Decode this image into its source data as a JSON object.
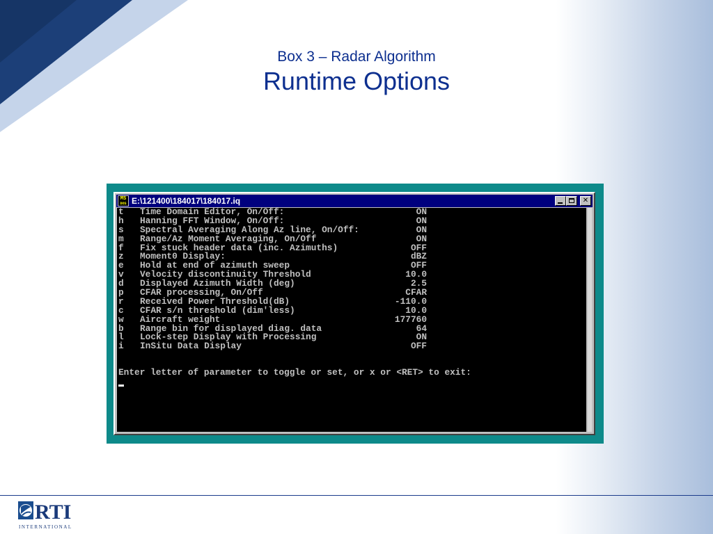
{
  "slide": {
    "title_small": "Box 3 – Radar Algorithm",
    "title_large": "Runtime Options",
    "logo_text": "RTI",
    "logo_subtext": "INTERNATIONAL"
  },
  "window": {
    "title": "E:\\121400\\184017\\184017.iq",
    "icon_text_top": "MS",
    "icon_text_bottom": "DOS",
    "minimize_label": "_",
    "maximize_label": "□",
    "close_label": "✕"
  },
  "console": {
    "options": [
      {
        "key": "t",
        "label": "Time Domain Editor, On/Off:",
        "value": "ON"
      },
      {
        "key": "h",
        "label": "Hanning FFT Window, On/Off:",
        "value": "ON"
      },
      {
        "key": "s",
        "label": "Spectral Averaging Along Az line, On/Off:",
        "value": "ON"
      },
      {
        "key": "m",
        "label": "Range/Az Moment Averaging, On/Off",
        "value": "ON"
      },
      {
        "key": "f",
        "label": "Fix stuck header data (inc. Azimuths)",
        "value": "OFF"
      },
      {
        "key": "z",
        "label": "Moment0 Display:",
        "value": "dBZ"
      },
      {
        "key": "e",
        "label": "Hold at end of azimuth sweep",
        "value": "OFF"
      },
      {
        "key": "v",
        "label": "Velocity discontinuity Threshold",
        "value": "10.0"
      },
      {
        "key": "d",
        "label": "Displayed Azimuth Width (deg)",
        "value": "2.5"
      },
      {
        "key": "p",
        "label": "CFAR processing, On/Off",
        "value": "CFAR"
      },
      {
        "key": "r",
        "label": "Received Power Threshold(dB)",
        "value": "-110.0"
      },
      {
        "key": "c",
        "label": "CFAR s/n threshold (dim'less)",
        "value": "10.0"
      },
      {
        "key": "w",
        "label": "Aircraft weight",
        "value": "177760"
      },
      {
        "key": "b",
        "label": "Range bin for displayed diag. data",
        "value": "64"
      },
      {
        "key": "l",
        "label": "Lock-step Display with Processing",
        "value": "ON"
      },
      {
        "key": "i",
        "label": "InSitu Data Display",
        "value": "OFF"
      }
    ],
    "prompt": "Enter letter of parameter to toggle or set, or x or <RET> to exit:"
  }
}
